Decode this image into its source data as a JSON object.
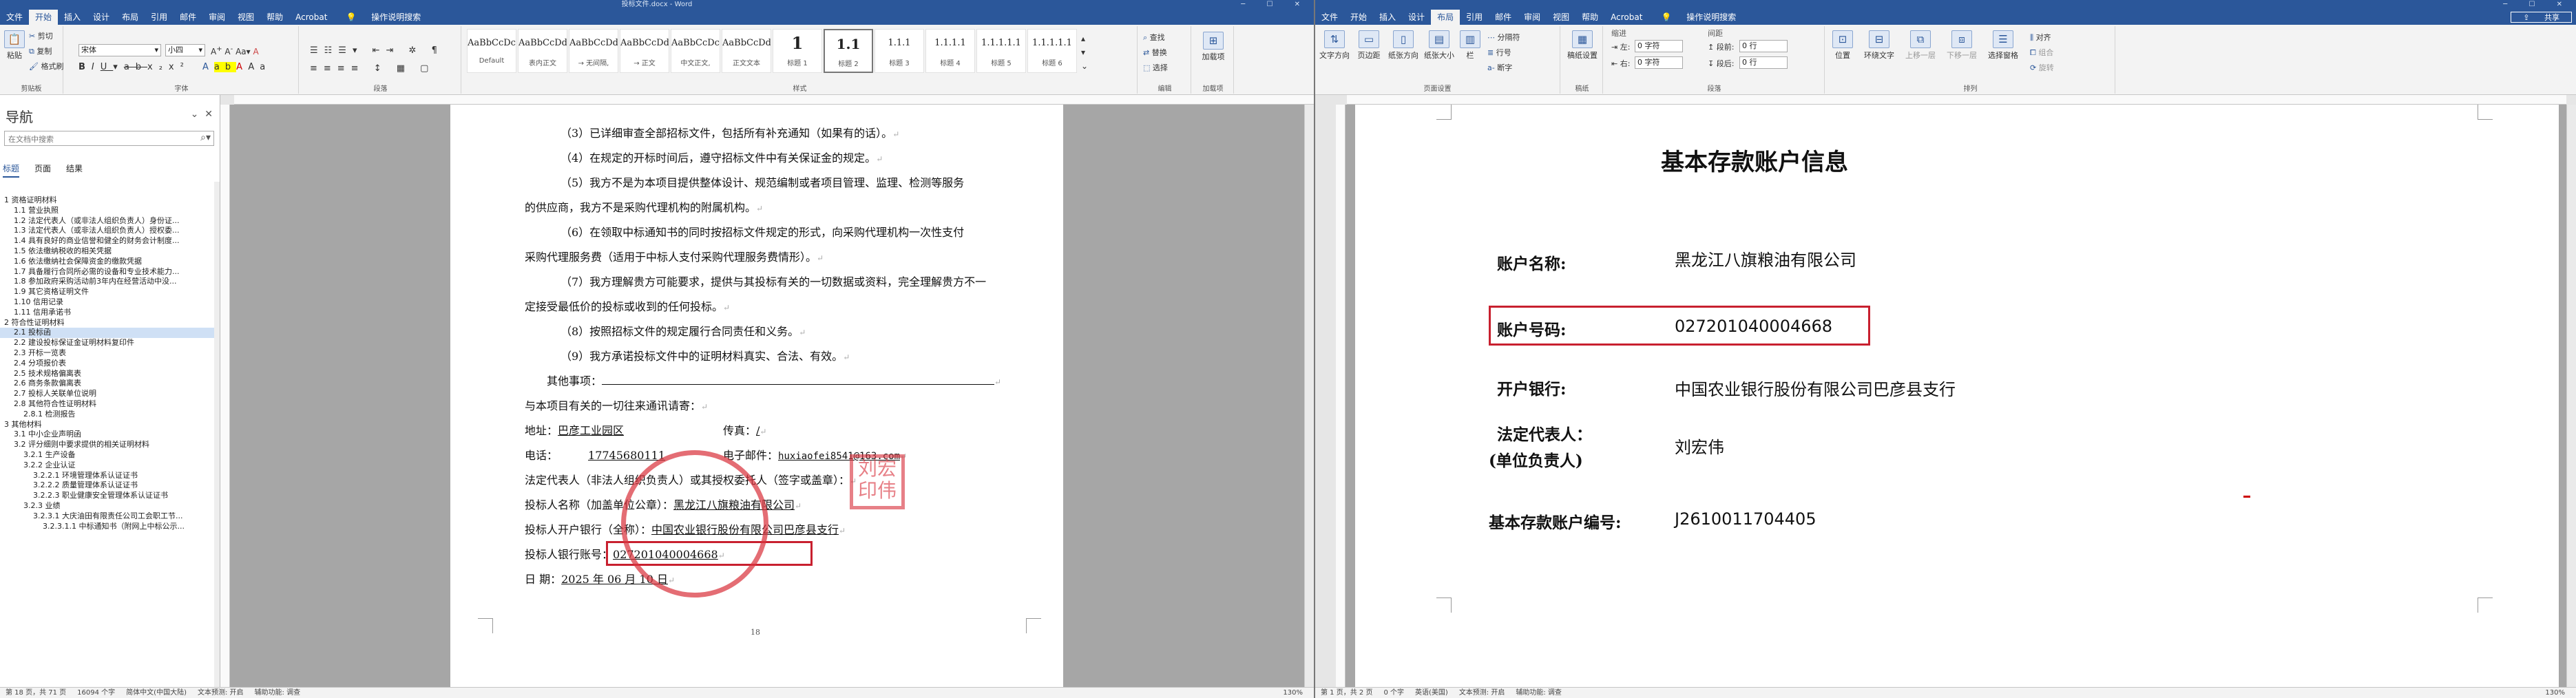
{
  "left": {
    "title": "投标文件.docx - Word",
    "tabs": [
      "文件",
      "开始",
      "插入",
      "设计",
      "布局",
      "引用",
      "邮件",
      "审阅",
      "视图",
      "帮助",
      "Acrobat"
    ],
    "active_tab": "开始",
    "tell_me": "操作说明搜索",
    "ribbon": {
      "paste": "粘贴",
      "cut": "剪切",
      "copy": "复制",
      "format_painter": "格式刷",
      "group_clipboard": "剪贴板",
      "font_name": "宋体",
      "font_size": "小四",
      "group_font": "字体",
      "group_paragraph": "段落",
      "group_styles": "样式",
      "styles": [
        {
          "preview": "AaBbCcDc",
          "name": "Default"
        },
        {
          "preview": "AaBbCcDd",
          "name": "表内正文"
        },
        {
          "preview": "AaBbCcDd",
          "name": "→ 无间隔,"
        },
        {
          "preview": "AaBbCcDd",
          "name": "→ 正文"
        },
        {
          "preview": "AaBbCcDc",
          "name": "中文正文,"
        },
        {
          "preview": "AaBbCcDd",
          "name": "正文文本"
        },
        {
          "preview": "1",
          "name": "标题 1"
        },
        {
          "preview": "1.1",
          "name": "标题 2"
        },
        {
          "preview": "1.1.1",
          "name": "标题 3"
        },
        {
          "preview": "1.1.1.1",
          "name": "标题 4"
        },
        {
          "preview": "1.1.1.1.1",
          "name": "标题 5"
        },
        {
          "preview": "1.1.1.1.1",
          "name": "标题 6"
        }
      ],
      "find": "查找",
      "replace": "替换",
      "select": "选择",
      "group_editing": "编辑",
      "addin": "加载项",
      "group_addin": "加载项"
    },
    "nav": {
      "title": "导航",
      "search_placeholder": "在文档中搜索",
      "tabs": [
        "标题",
        "页面",
        "结果"
      ],
      "items": [
        "1 资格证明材料",
        "1.1 营业执照",
        "1.2 法定代表人（或非法人组织负责人）身份证...",
        "1.3 法定代表人（或非法人组织负责人）授权委...",
        "1.4 具有良好的商业信誉和健全的财务会计制度...",
        "1.5 依法缴纳税收的相关凭据",
        "1.6 依法缴纳社会保障资金的缴款凭据",
        "1.7 具备履行合同所必需的设备和专业技术能力...",
        "1.8 参加政府采购活动前3年内在经营活动中没...",
        "1.9 其它资格证明文件",
        "1.10 信用记录",
        "1.11 信用承诺书",
        "2 符合性证明材料",
        "2.1 投标函",
        "2.2 建设投标保证金证明材料复印件",
        "2.3 开标一览表",
        "2.4 分项报价表",
        "2.5 技术规格偏离表",
        "2.6 商务条款偏离表",
        "2.7 投标人关联单位说明",
        "2.8 其他符合性证明材料",
        "2.8.1 检测报告",
        "3 其他材料",
        "3.1 中小企业声明函",
        "3.2 评分细则中要求提供的相关证明材料",
        "3.2.1 生产设备",
        "3.2.2 企业认证",
        "3.2.2.1 环境管理体系认证证书",
        "3.2.2.2 质量管理体系认证证书",
        "3.2.2.3 职业健康安全管理体系认证证书",
        "3.2.3 业绩",
        "3.2.3.1 大庆油田有限责任公司工会职工节...",
        "3.2.3.1.1 中标通知书（附网上中标公示..."
      ],
      "current_index": 13
    },
    "doc": {
      "lines": [
        "（3）已详细审查全部招标文件，包括所有补充通知（如果有的话）。",
        "（4）在规定的开标时间后，遵守招标文件中有关保证金的规定。",
        "（5）我方不是为本项目提供整体设计、规范编制或者项目管理、监理、检测等服务",
        "的供应商，我方不是采购代理机构的附属机构。",
        "（6）在领取中标通知书的同时按招标文件规定的形式，向采购代理机构一次性支付",
        "采购代理服务费（适用于中标人支付采购代理服务费情形）。",
        "（7）我方理解贵方可能要求，提供与其投标有关的一切数据或资料，完全理解贵方不一",
        "定接受最低价的投标或收到的任何投标。",
        "（8）按照招标文件的规定履行合同责任和义务。",
        "（9）我方承诺投标文件中的证明材料真实、合法、有效。"
      ],
      "other_matters": "其他事项：",
      "contact_intro": "与本项目有关的一切往来通讯请寄：",
      "address_label": "地址：",
      "address_value": "巴彦工业园区",
      "fax_label": "传真：",
      "fax_value": "/",
      "phone_label": "电话：",
      "phone_value": "17745680111",
      "email_label": "电子邮件：",
      "email_value": "huxiaofei8541@163.com",
      "legal_rep": "法定代表人（非法人组织负责人）或其授权委托人（签字或盖章）：",
      "bidder_name_label": "投标人名称（加盖单位公章）：",
      "bidder_name_value": "黑龙江八旗粮油有限公司",
      "bank_label": "投标人开户银行（全称）：",
      "bank_value": "中国农业银行股份有限公司巴彦县支行",
      "account_label": "投标人银行账号：",
      "account_value": "027201040004668",
      "date_label": "日    期：",
      "date_value": "2025 年 06 月 10 日",
      "page_number": "18",
      "stamp_text": "刘宏\n印伟"
    },
    "status": {
      "page": "第 18 页，共 71 页",
      "words": "16094 个字",
      "lang": "简体中文(中国大陆)",
      "text_predict": "文本预测: 开启",
      "access": "辅助功能: 调查",
      "zoom": "130%"
    }
  },
  "right": {
    "share": "共享",
    "tabs": [
      "文件",
      "开始",
      "插入",
      "设计",
      "布局",
      "引用",
      "邮件",
      "审阅",
      "视图",
      "帮助",
      "Acrobat"
    ],
    "active_tab": "布局",
    "tell_me": "操作说明搜索",
    "ribbon": {
      "text_direction": "文字方向",
      "margins": "页边距",
      "orientation": "纸张方向",
      "size": "纸张大小",
      "columns": "栏",
      "breaks": "分隔符",
      "line_numbers": "行号",
      "hyphenation": "断字",
      "group_page_setup": "页面设置",
      "draft_paper": "稿纸设置",
      "group_draft": "稿纸",
      "indent_title": "缩进",
      "indent_left_label": "左:",
      "indent_left": "0 字符",
      "indent_right_label": "右:",
      "indent_right": "0 字符",
      "spacing_title": "间距",
      "spacing_before_label": "段前:",
      "spacing_before": "0 行",
      "spacing_after_label": "段后:",
      "spacing_after": "0 行",
      "group_paragraph": "段落",
      "position": "位置",
      "wrap_text": "环绕文字",
      "bring_forward": "上移一层",
      "send_backward": "下移一层",
      "selection_pane": "选择窗格",
      "align": "对齐",
      "group": "组合",
      "rotate": "旋转",
      "group_arrange": "排列"
    },
    "doc": {
      "title": "基本存款账户信息",
      "rows": [
        {
          "label": "账户名称:",
          "value": "黑龙江八旗粮油有限公司"
        },
        {
          "label": "账户号码:",
          "value": "027201040004668"
        },
        {
          "label": "开户银行:",
          "value": "中国农业银行股份有限公司巴彦县支行"
        },
        {
          "label": "法定代表人：",
          "label2": "(单位负责人)",
          "value": "刘宏伟"
        },
        {
          "label": "基本存款账户编号:",
          "value": "J2610011704405"
        }
      ]
    },
    "status": {
      "page": "第 1 页，共 2 页",
      "words": "0 个字",
      "lang": "英语(美国)",
      "text_predict": "文本预测: 开启",
      "access": "辅助功能: 调查",
      "zoom": "130%"
    }
  }
}
